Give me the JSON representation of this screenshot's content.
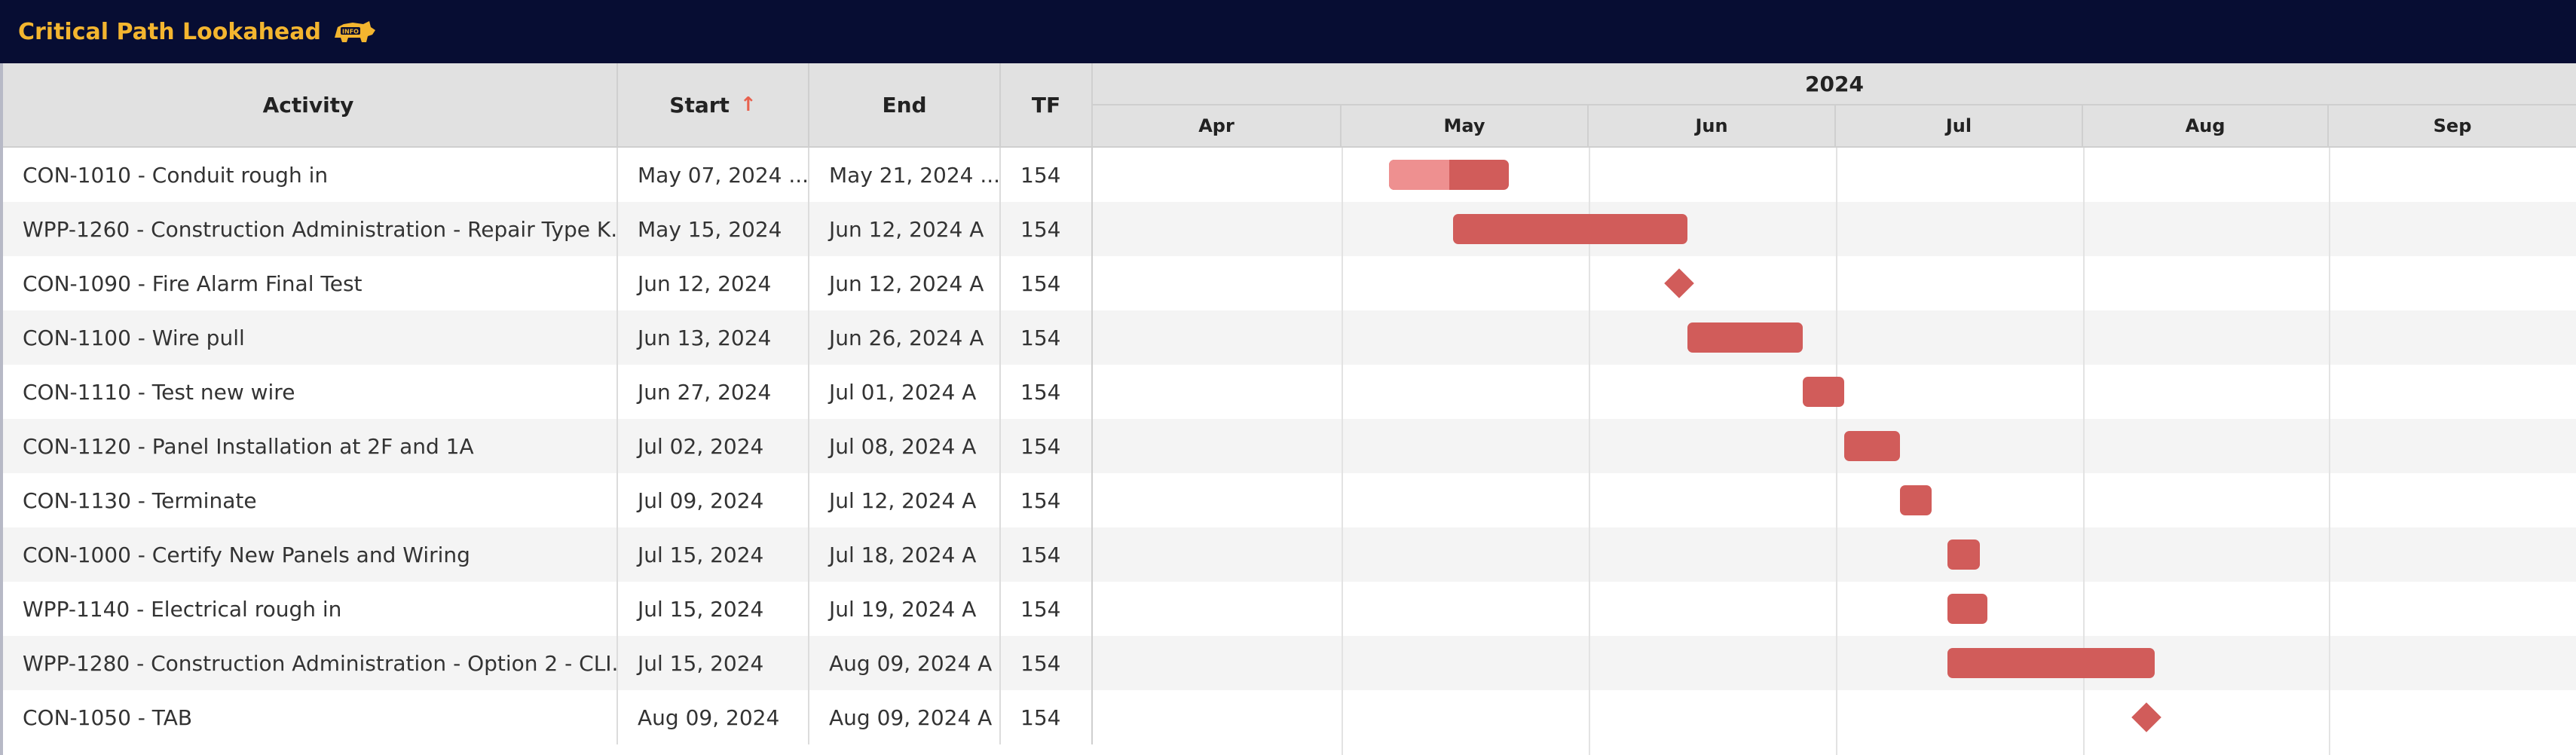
{
  "header": {
    "title": "Critical Path Lookahead",
    "logo_icon": "rhino-logo-icon",
    "accent": "#f3b52f",
    "background": "#070d33"
  },
  "columns": {
    "activity": "Activity",
    "start": "Start",
    "end": "End",
    "tf": "TF",
    "sort_icon": "↑"
  },
  "timeline": {
    "year": "2024",
    "months": [
      "Apr",
      "May",
      "Jun",
      "Jul",
      "Aug",
      "Sep"
    ],
    "bar_color": "#d15c5a",
    "progress_color": "#ee9090"
  },
  "rows": [
    {
      "activity": "CON-1010 - Conduit rough in",
      "start": "May 07, 2024 ...",
      "end": "May 21, 2024 ...",
      "tf": "154",
      "type": "bar",
      "start_date": "2024-05-07",
      "end_date": "2024-05-21",
      "progress": 0.5
    },
    {
      "activity": "WPP-1260 - Construction Administration - Repair Type K...",
      "start": "May 15, 2024",
      "end": "Jun 12, 2024 A",
      "tf": "154",
      "type": "bar",
      "start_date": "2024-05-15",
      "end_date": "2024-06-12",
      "progress": 0
    },
    {
      "activity": "CON-1090 - Fire Alarm Final Test",
      "start": "Jun 12, 2024",
      "end": "Jun 12, 2024 A",
      "tf": "154",
      "type": "milestone",
      "start_date": "2024-06-12",
      "end_date": "2024-06-12",
      "progress": 0
    },
    {
      "activity": "CON-1100 - Wire pull",
      "start": "Jun 13, 2024",
      "end": "Jun 26, 2024 A",
      "tf": "154",
      "type": "bar",
      "start_date": "2024-06-13",
      "end_date": "2024-06-26",
      "progress": 0
    },
    {
      "activity": "CON-1110 - Test new wire",
      "start": "Jun 27, 2024",
      "end": "Jul 01, 2024 A",
      "tf": "154",
      "type": "bar",
      "start_date": "2024-06-27",
      "end_date": "2024-07-01",
      "progress": 0
    },
    {
      "activity": "CON-1120 - Panel Installation at 2F and 1A",
      "start": "Jul 02, 2024",
      "end": "Jul 08, 2024 A",
      "tf": "154",
      "type": "bar",
      "start_date": "2024-07-02",
      "end_date": "2024-07-08",
      "progress": 0
    },
    {
      "activity": "CON-1130 - Terminate",
      "start": "Jul 09, 2024",
      "end": "Jul 12, 2024 A",
      "tf": "154",
      "type": "bar",
      "start_date": "2024-07-09",
      "end_date": "2024-07-12",
      "progress": 0
    },
    {
      "activity": "CON-1000 - Certify New Panels and Wiring",
      "start": "Jul 15, 2024",
      "end": "Jul 18, 2024 A",
      "tf": "154",
      "type": "bar",
      "start_date": "2024-07-15",
      "end_date": "2024-07-18",
      "progress": 0
    },
    {
      "activity": "WPP-1140 - Electrical rough in",
      "start": "Jul 15, 2024",
      "end": "Jul 19, 2024 A",
      "tf": "154",
      "type": "bar",
      "start_date": "2024-07-15",
      "end_date": "2024-07-19",
      "progress": 0
    },
    {
      "activity": "WPP-1280 - Construction Administration - Option 2 - CLI...",
      "start": "Jul 15, 2024",
      "end": "Aug 09, 2024 A",
      "tf": "154",
      "type": "bar",
      "start_date": "2024-07-15",
      "end_date": "2024-08-09",
      "progress": 0
    },
    {
      "activity": "CON-1050 - TAB",
      "start": "Aug 09, 2024",
      "end": "Aug 09, 2024 A",
      "tf": "154",
      "type": "milestone",
      "start_date": "2024-08-09",
      "end_date": "2024-08-09",
      "progress": 0
    }
  ]
}
